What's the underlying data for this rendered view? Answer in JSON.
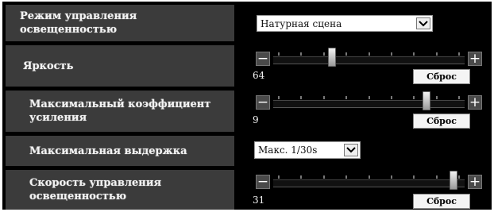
{
  "settings": {
    "light_control_mode": {
      "label": "Режим управления освещенностью",
      "value": "Натурная сцена"
    },
    "brightness": {
      "label": "Яркость",
      "minus": "−",
      "plus": "+",
      "value": "64",
      "level": 0.3,
      "reset": "Сброс"
    },
    "max_gain": {
      "label": "Максимальный коэффициент усиления",
      "minus": "−",
      "plus": "+",
      "value": "9",
      "level": 0.82,
      "reset": "Сброс"
    },
    "max_shutter": {
      "label": "Максимальная выдержка",
      "value": "Макс. 1/30s"
    },
    "light_control_speed": {
      "label": "Скорость управления освещенностью",
      "minus": "−",
      "plus": "+",
      "value": "31",
      "level": 0.97,
      "reset": "Сброс"
    }
  }
}
